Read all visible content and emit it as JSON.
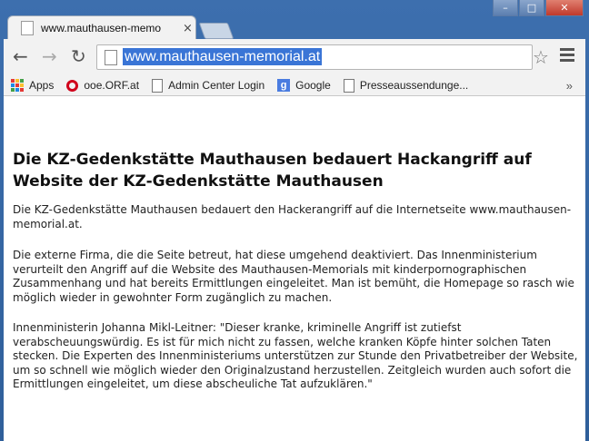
{
  "window": {
    "minimize_glyph": "–",
    "maximize_glyph": "□",
    "close_glyph": "✕"
  },
  "tab": {
    "title": "www.mauthausen-memo",
    "close_glyph": "×"
  },
  "toolbar": {
    "back_glyph": "←",
    "forward_glyph": "→",
    "reload_glyph": "↻",
    "url": "www.mauthausen-memorial.at",
    "star_glyph": "☆"
  },
  "bookmarks": {
    "items": [
      {
        "label": "Apps",
        "icon": "apps-icon"
      },
      {
        "label": "ooe.ORF.at",
        "icon": "orf-icon"
      },
      {
        "label": "Admin Center Login",
        "icon": "page-icon"
      },
      {
        "label": "Google",
        "icon": "google-icon"
      },
      {
        "label": "Presseaussendunge...",
        "icon": "page-icon"
      }
    ],
    "overflow_glyph": "»"
  },
  "article": {
    "heading": "Die KZ-Gedenkstätte Mauthausen bedauert Hackangriff auf Website der KZ-Gedenkstätte Mauthausen",
    "p1": "Die KZ-Gedenkstätte Mauthausen bedauert den Hackerangriff auf die Internetseite www.mauthausen-memorial.at.",
    "p2": "Die externe Firma, die die Seite betreut, hat diese umgehend deaktiviert. Das Innenministerium verurteilt den Angriff auf die Website des Mauthausen-Memorials mit kinderpornographischen Zusammenhang und hat bereits Ermittlungen eingeleitet. Man ist bemüht, die Homepage so rasch wie möglich wieder in gewohnter Form zugänglich zu machen.",
    "p3": "Innenministerin Johanna Mikl-Leitner: \"Dieser kranke, kriminelle Angriff ist zutiefst verabscheuungswürdig. Es ist für mich nicht zu fassen, welche kranken Köpfe hinter solchen Taten stecken. Die Experten des Innenministeriums unterstützen zur Stunde den Privatbetreiber der Website, um so schnell wie möglich wieder den Originalzustand herzustellen. Zeitgleich wurden auch sofort die Ermittlungen eingeleitet, um diese abscheuliche Tat aufzuklären.\""
  }
}
